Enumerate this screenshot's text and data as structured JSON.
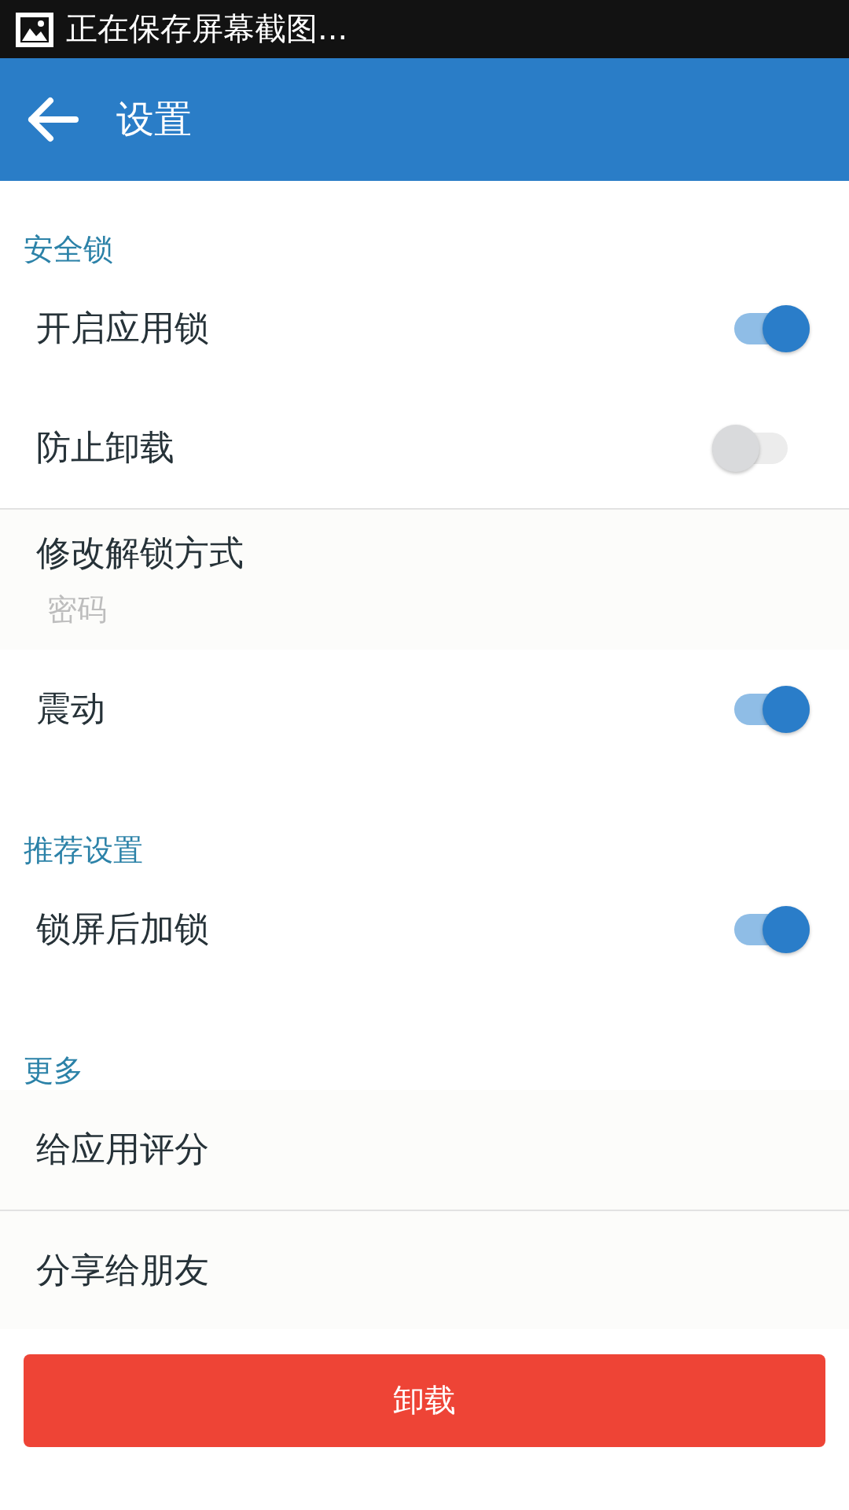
{
  "status_bar": {
    "notification": "正在保存屏幕截图..."
  },
  "app_bar": {
    "title": "设置"
  },
  "sections": [
    {
      "title": "安全锁",
      "items": [
        {
          "kind": "toggle",
          "label": "开启应用锁",
          "checked": true
        },
        {
          "kind": "toggle",
          "label": "防止卸载",
          "checked": false
        },
        {
          "kind": "choice",
          "label": "修改解锁方式",
          "value": "密码"
        },
        {
          "kind": "toggle",
          "label": "震动",
          "checked": true
        }
      ]
    },
    {
      "title": "推荐设置",
      "items": [
        {
          "kind": "toggle",
          "label": "锁屏后加锁",
          "checked": true
        }
      ]
    },
    {
      "title": "更多",
      "items": [
        {
          "kind": "link",
          "label": "给应用评分"
        },
        {
          "kind": "link",
          "label": "分享给朋友"
        }
      ]
    }
  ],
  "uninstall_button": "卸载"
}
